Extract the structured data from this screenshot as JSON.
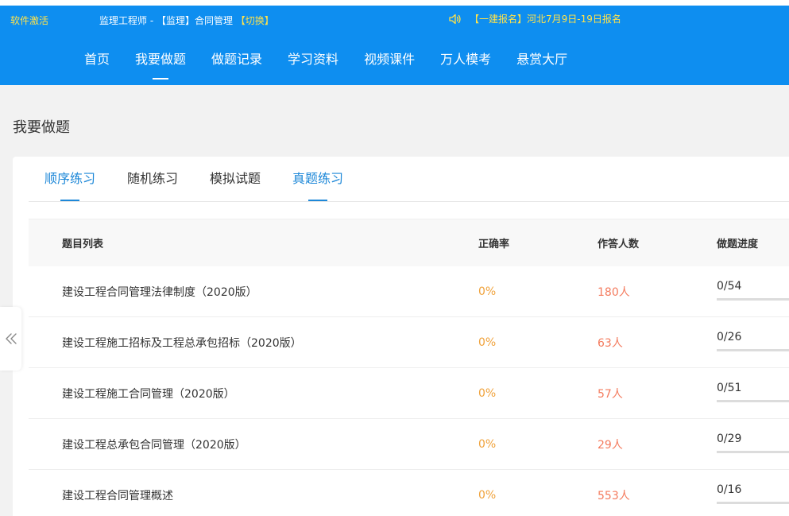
{
  "header": {
    "activate_label": "软件激活",
    "course_text": "监理工程师 - 【监理】合同管理 ",
    "switch_label": "【切换】",
    "notice_text": "【一建报名】河北7月9日-19日报名",
    "speaker_icon": "speaker-icon"
  },
  "nav": {
    "items": [
      {
        "label": "首页"
      },
      {
        "label": "我要做题"
      },
      {
        "label": "做题记录"
      },
      {
        "label": "学习资料"
      },
      {
        "label": "视频课件"
      },
      {
        "label": "万人模考"
      },
      {
        "label": "悬赏大厅"
      }
    ],
    "active_index": 1
  },
  "page": {
    "title": "我要做题"
  },
  "tabs": {
    "items": [
      {
        "label": "顺序练习"
      },
      {
        "label": "随机练习"
      },
      {
        "label": "模拟试题"
      },
      {
        "label": "真题练习"
      }
    ],
    "active_indices": [
      0,
      3
    ]
  },
  "table": {
    "headers": {
      "name": "题目列表",
      "rate": "正确率",
      "count": "作答人数",
      "progress": "做题进度"
    },
    "rows": [
      {
        "name": "建设工程合同管理法律制度（2020版）",
        "rate": "0%",
        "count": "180人",
        "progress": "0/54",
        "progress_fraction": 0
      },
      {
        "name": "建设工程施工招标及工程总承包招标（2020版）",
        "rate": "0%",
        "count": "63人",
        "progress": "0/26",
        "progress_fraction": 0
      },
      {
        "name": "建设工程施工合同管理（2020版）",
        "rate": "0%",
        "count": "57人",
        "progress": "0/51",
        "progress_fraction": 0
      },
      {
        "name": "建设工程总承包合同管理（2020版）",
        "rate": "0%",
        "count": "29人",
        "progress": "0/29",
        "progress_fraction": 0
      },
      {
        "name": "建设工程合同管理概述",
        "rate": "0%",
        "count": "553人",
        "progress": "0/16",
        "progress_fraction": 0
      }
    ]
  },
  "sidebar_toggle": {
    "icon": "double-chevron-left-icon"
  },
  "colors": {
    "header_bg": "#0e8ef0",
    "accent": "#1e88d8",
    "highlight_text": "#ffe24a",
    "rate_color": "#f0a23b",
    "count_color": "#f47b5e"
  }
}
